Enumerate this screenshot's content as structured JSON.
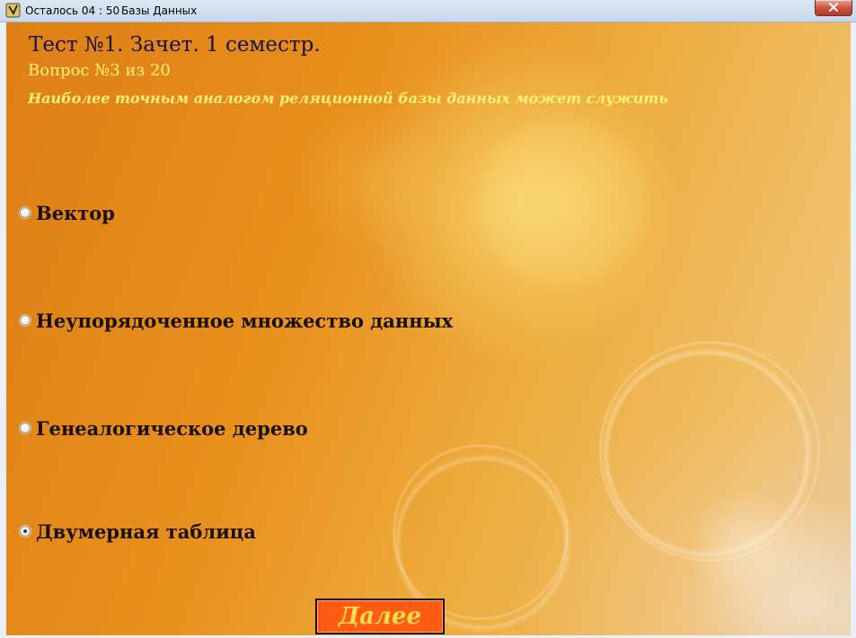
{
  "window": {
    "timer": "Осталось 04 : 50",
    "title": "Базы Данных"
  },
  "header": {
    "test_title": "Тест №1. Зачет. 1 семестр.",
    "question_counter": "Вопрос №3 из 20",
    "question_text": "Наиболее точным аналогом реляционной базы данных может служить"
  },
  "options": [
    {
      "label": "Вектор",
      "checked": false
    },
    {
      "label": "Неупорядоченное множество данных",
      "checked": false
    },
    {
      "label": "Генеалогическое дерево",
      "checked": false
    },
    {
      "label": "Двумерная таблица",
      "checked": true
    }
  ],
  "next_button": {
    "label": "Далее"
  },
  "colors": {
    "background_accent": "#e8901c",
    "counter_text": "#fff27a",
    "button_fill": "#ff5b12",
    "button_text": "#ffe04a"
  }
}
